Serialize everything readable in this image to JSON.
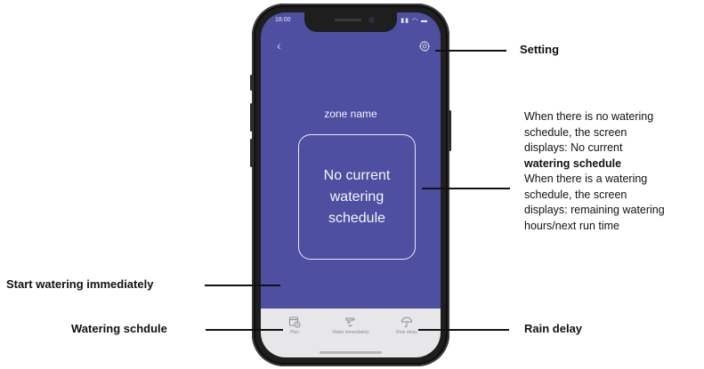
{
  "phone": {
    "status_time": "18:00",
    "status_icons": "▮▮ ◠ ▬",
    "back_glyph": "‹",
    "zone_name": "zone name",
    "schedule_lines": [
      "No current",
      "watering",
      "schedule"
    ],
    "tabs": [
      {
        "label": "Plan",
        "icon": "calendar-clock-icon"
      },
      {
        "label": "Water immediately",
        "icon": "faucet-icon"
      },
      {
        "label": "Rain delay",
        "icon": "umbrella-icon"
      }
    ],
    "colors": {
      "screen_bg": "#4f4fa1",
      "bottom_bar": "#e7e7ea",
      "frame": "#1e1e1e"
    }
  },
  "annotations": {
    "setting": "Setting",
    "start_watering": "Start watering immediately",
    "watering_schedule": "Watering schdule",
    "rain_delay": "Rain delay",
    "description_lines": [
      "When there is no watering",
      "schedule, the screen",
      "displays: No current",
      "watering schedule",
      "When there is a watering",
      "schedule, the screen",
      "displays: remaining watering",
      "hours/next run time"
    ]
  }
}
